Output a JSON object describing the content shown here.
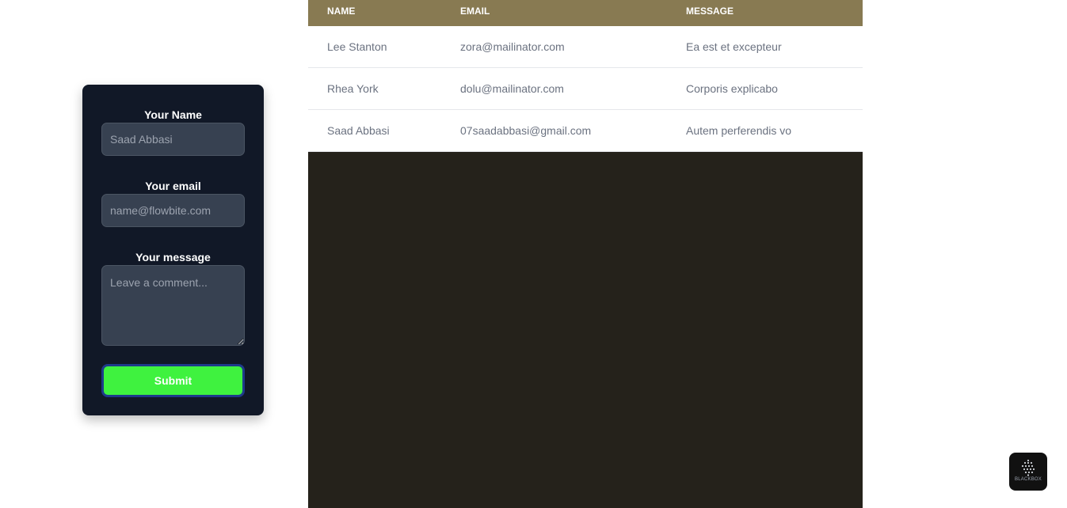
{
  "form": {
    "name_label": "Your Name",
    "name_placeholder": "Saad Abbasi",
    "email_label": "Your email",
    "email_placeholder": "name@flowbite.com",
    "message_label": "Your message",
    "message_placeholder": "Leave a comment...",
    "submit_label": "Submit"
  },
  "table": {
    "headers": [
      "NAME",
      "EMAIL",
      "MESSAGE"
    ],
    "rows": [
      [
        "Lee Stanton",
        "zora@mailinator.com",
        "Ea est et excepteur"
      ],
      [
        "Rhea York",
        "dolu@mailinator.com",
        "Corporis explicabo"
      ],
      [
        "Saad Abbasi",
        "07saadabbasi@gmail.com",
        "Autem perferendis vo"
      ]
    ]
  },
  "widget": {
    "label": "BLACKBOX",
    "icon": "dot-grid-icon"
  },
  "colors": {
    "form_bg": "#111827",
    "field_bg": "#374151",
    "submit_bg": "#3ff23f",
    "table_header_bg": "#887a52",
    "dark_panel_bg": "#25221b"
  }
}
